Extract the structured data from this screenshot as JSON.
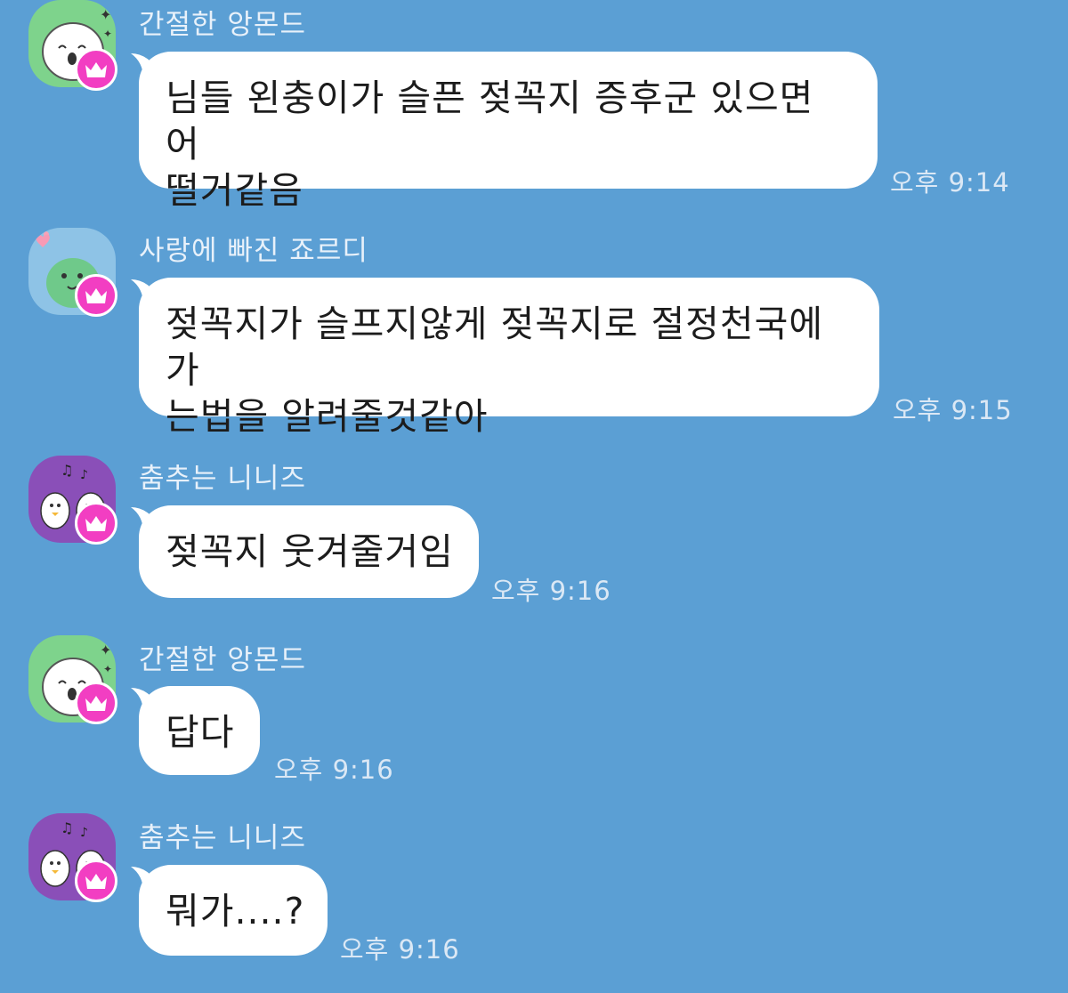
{
  "messages": [
    {
      "sender": "간절한 앙몬드",
      "text": "님들 왼충이가 슬픈 젖꼭지 증후군 있으면 어\n떨거같음",
      "time": "오후 9:14",
      "avatar_icon": "almond-avatar-icon"
    },
    {
      "sender": "사랑에 빠진 죠르디",
      "text": "젖꼭지가 슬프지않게 젖꼭지로 절정천국에가\n는법을 알려줄것같아",
      "time": "오후 9:15",
      "avatar_icon": "jordy-avatar-icon"
    },
    {
      "sender": "춤추는 니니즈",
      "text": "젖꼭지 웃겨줄거임",
      "time": "오후 9:16",
      "avatar_icon": "niniz-avatar-icon"
    },
    {
      "sender": "간절한 앙몬드",
      "text": "답다",
      "time": "오후 9:16",
      "avatar_icon": "almond-avatar-icon"
    },
    {
      "sender": "춤추는 니니즈",
      "text": "뭐가....?",
      "time": "오후 9:16",
      "avatar_icon": "niniz-avatar-icon"
    }
  ],
  "colors": {
    "background": "#5b9fd4",
    "bubble": "#ffffff",
    "crown_badge": "#f23ec2",
    "avatar_almond": "#7ed38c",
    "avatar_jordy": "#8ec3e6",
    "avatar_niniz": "#8a4fb8"
  },
  "badge_icon": "crown-icon"
}
